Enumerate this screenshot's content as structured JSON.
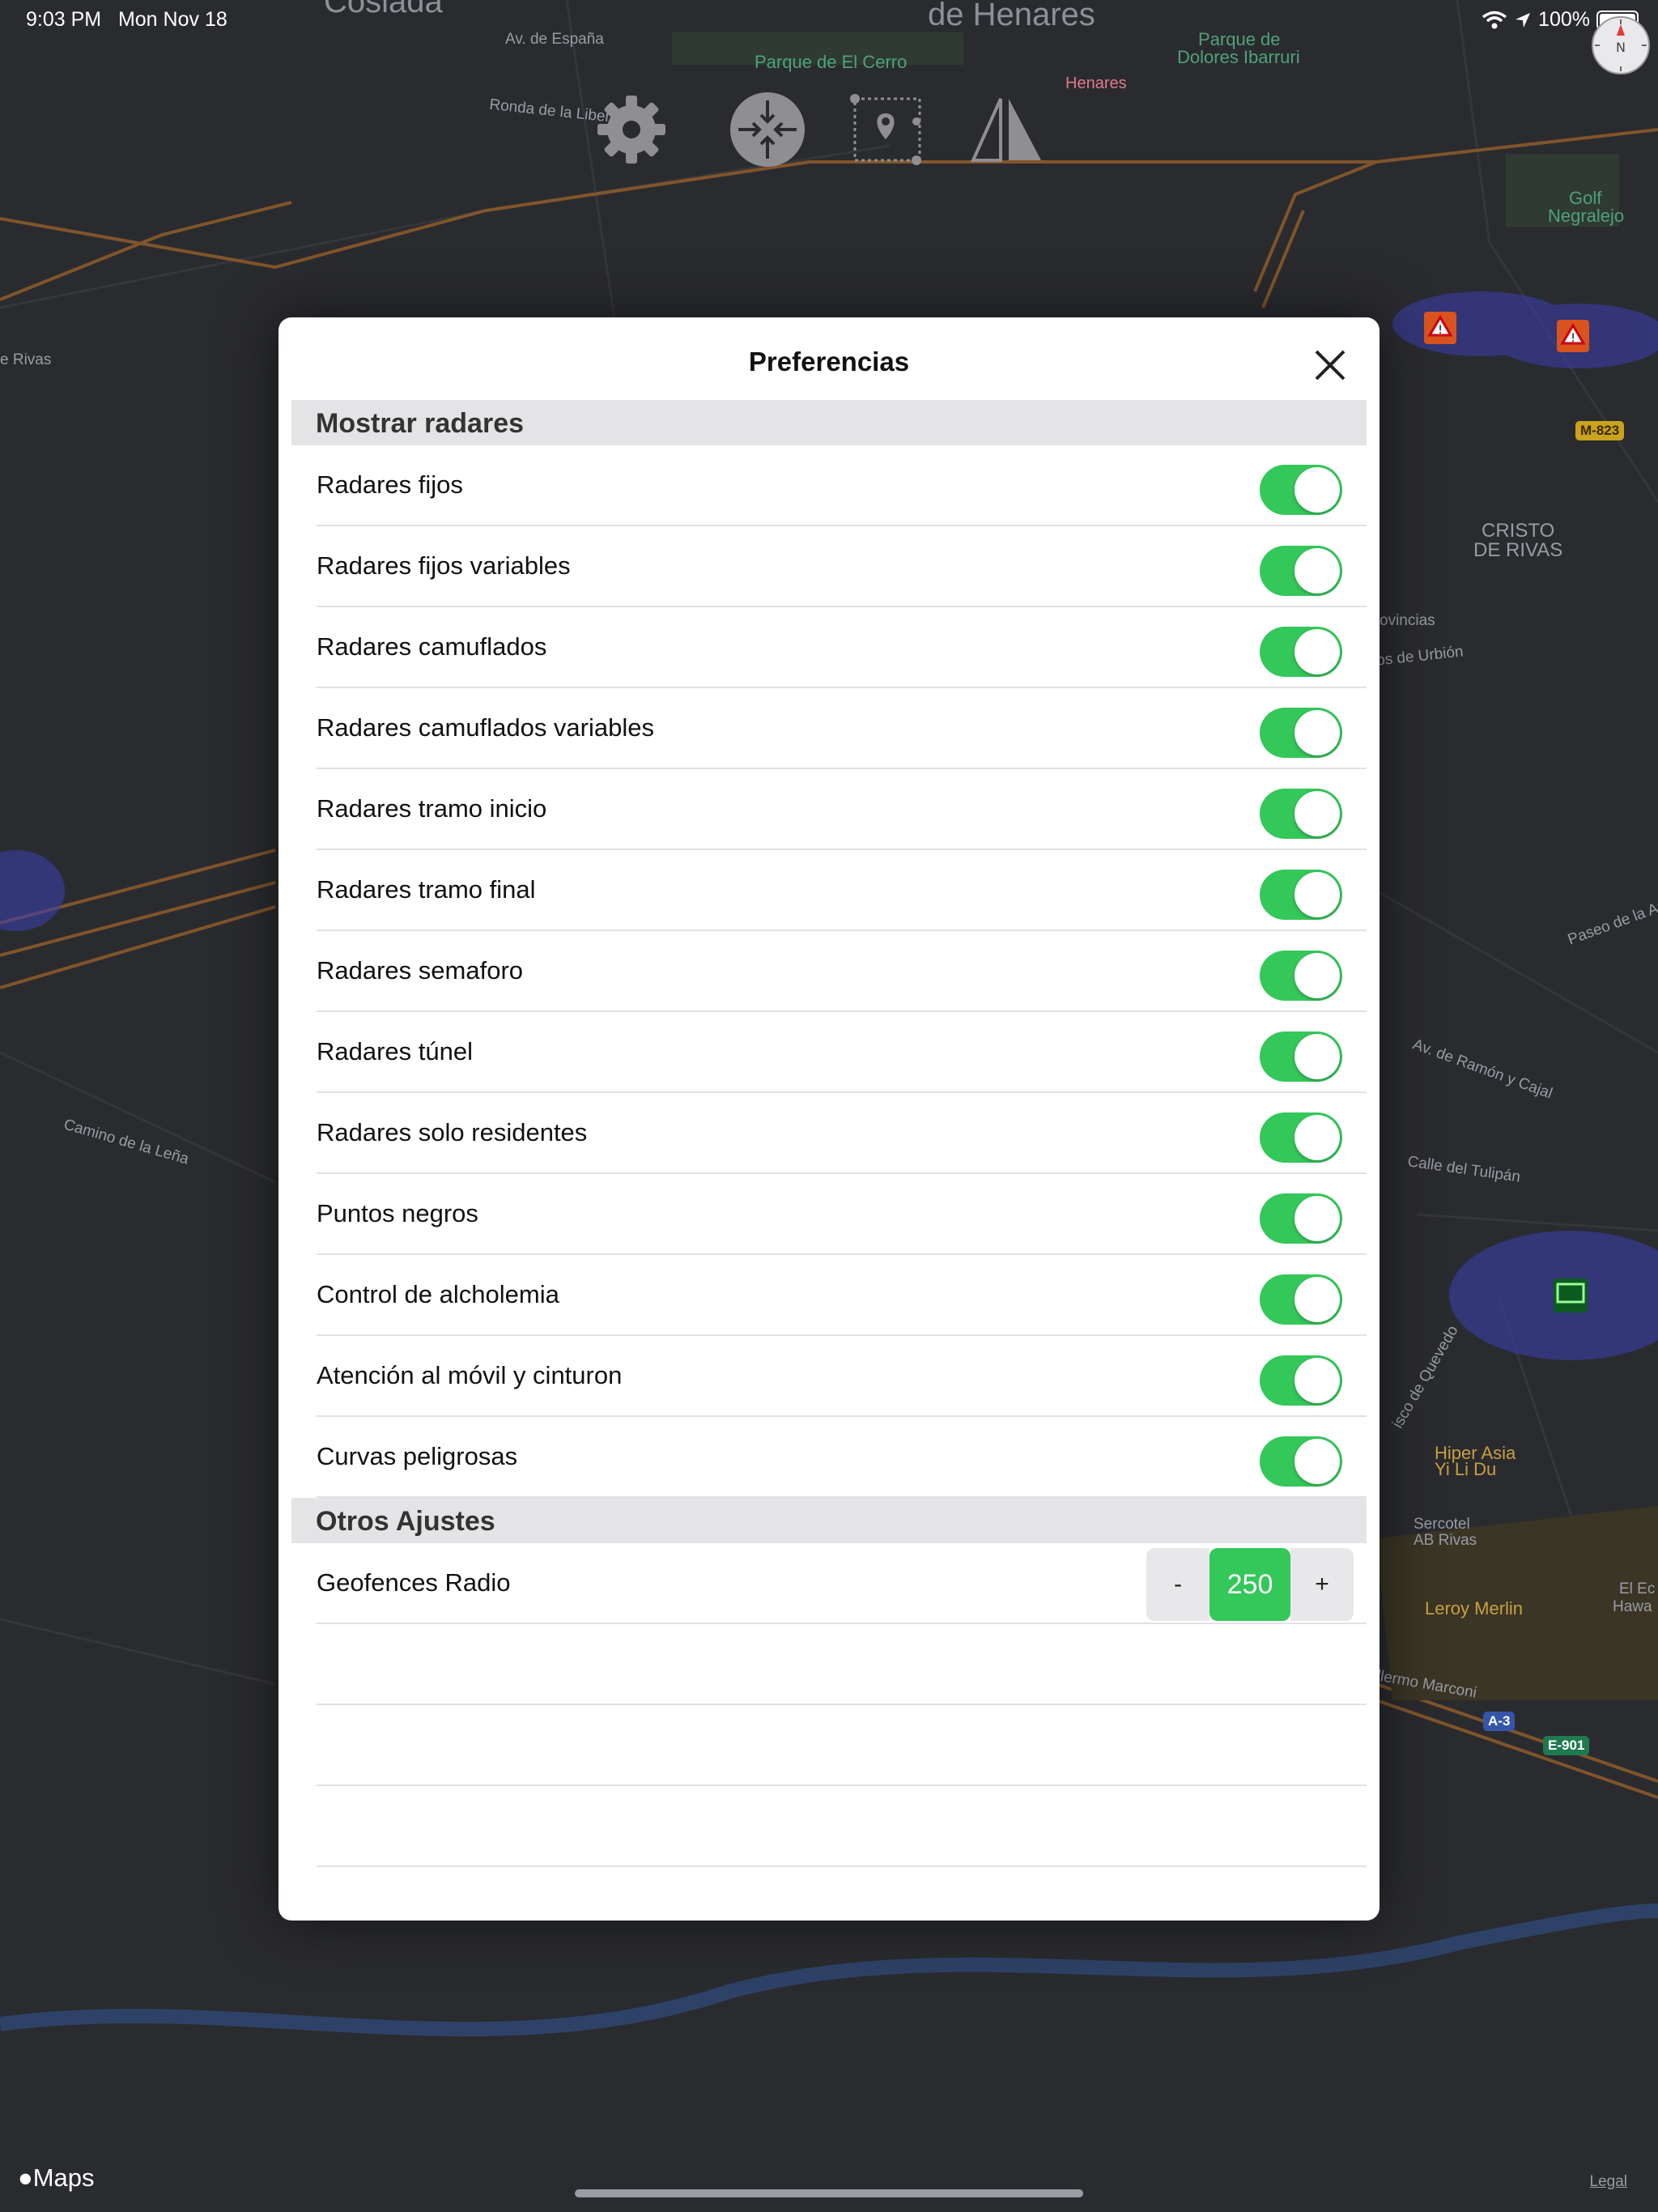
{
  "status_bar": {
    "time": "9:03 PM",
    "date": "Mon Nov 18",
    "battery": "100%"
  },
  "map": {
    "labels": [
      {
        "text": "Coslada",
        "kind": "big"
      },
      {
        "text": "de Henares",
        "kind": "big"
      },
      {
        "text": "Av. de España",
        "kind": "street"
      },
      {
        "text": "Ronda de la Libertad",
        "kind": "street"
      },
      {
        "text": "Parque de El Cerro",
        "kind": "park"
      },
      {
        "text": "Henares",
        "kind": "hospital"
      },
      {
        "text": "Parque de",
        "kind": "park"
      },
      {
        "text": "Dolores Ibarruri",
        "kind": "park"
      },
      {
        "text": "Golf",
        "kind": "park"
      },
      {
        "text": "Negralejo",
        "kind": "park"
      },
      {
        "text": "e Rivas",
        "kind": "street"
      },
      {
        "text": "CRISTO",
        "kind": "district"
      },
      {
        "text": "DE RIVAS",
        "kind": "district"
      },
      {
        "text": "ovincias",
        "kind": "street"
      },
      {
        "text": "os de Urbión",
        "kind": "street"
      },
      {
        "text": "Paseo de la Ar",
        "kind": "street"
      },
      {
        "text": "Av. de Ramón y Cajal",
        "kind": "street"
      },
      {
        "text": "Calle del Tulipán",
        "kind": "street"
      },
      {
        "text": "Camino de la Leña",
        "kind": "street"
      },
      {
        "text": "isco de Quevedo",
        "kind": "street"
      },
      {
        "text": "Hiper Asia",
        "kind": "poi"
      },
      {
        "text": "Yi Li Du",
        "kind": "poi"
      },
      {
        "text": "Sercotel",
        "kind": "street"
      },
      {
        "text": "AB Rivas",
        "kind": "street"
      },
      {
        "text": "Leroy Merlin",
        "kind": "poi"
      },
      {
        "text": "El Ec",
        "kind": "street"
      },
      {
        "text": "Hawa",
        "kind": "street"
      },
      {
        "text": "llermo Marconi",
        "kind": "street"
      }
    ],
    "shields": [
      "M-823",
      "A-3",
      "E-901"
    ],
    "maps_logo": "Maps",
    "legal": "Legal"
  },
  "toolbar": {
    "icons": [
      "gear-icon",
      "recenter-icon",
      "route-area-icon",
      "layers-icon"
    ]
  },
  "modal": {
    "title": "Preferencias",
    "section_radars": "Mostrar radares",
    "toggles": [
      {
        "label": "Radares fijos",
        "on": true
      },
      {
        "label": "Radares fijos variables",
        "on": true
      },
      {
        "label": "Radares camuflados",
        "on": true
      },
      {
        "label": "Radares camuflados variables",
        "on": true
      },
      {
        "label": "Radares tramo inicio",
        "on": true
      },
      {
        "label": "Radares tramo final",
        "on": true
      },
      {
        "label": "Radares semaforo",
        "on": true
      },
      {
        "label": "Radares túnel",
        "on": true
      },
      {
        "label": "Radares solo residentes",
        "on": true
      },
      {
        "label": "Puntos negros",
        "on": true
      },
      {
        "label": "Control de alcholemia",
        "on": true
      },
      {
        "label": "Atención al móvil y cinturon",
        "on": true
      },
      {
        "label": "Curvas peligrosas",
        "on": true
      }
    ],
    "section_other": "Otros Ajustes",
    "geofence": {
      "label": "Geofences Radio",
      "minus": "-",
      "value": "250",
      "plus": "+"
    }
  },
  "colors": {
    "accent_green": "#34c759",
    "map_background": "#2a2b2f"
  }
}
